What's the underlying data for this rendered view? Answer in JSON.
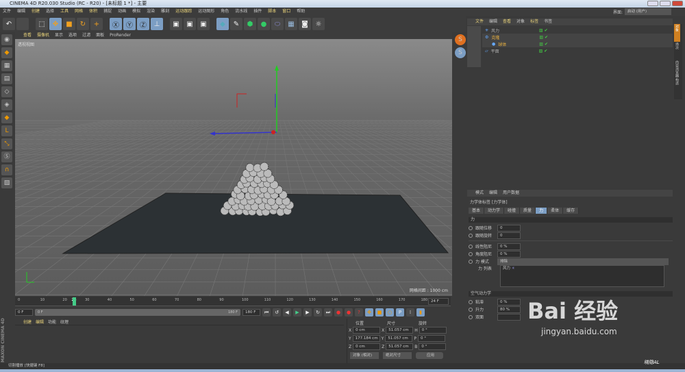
{
  "window": {
    "title": "CINEMA 4D R20.030 Studio (RC - R20) - [未标题 1 *] - 主要"
  },
  "menu": [
    {
      "label": "文件"
    },
    {
      "label": "编辑"
    },
    {
      "label": "创建",
      "hl": true
    },
    {
      "label": "选择"
    },
    {
      "label": "工具",
      "hl": true
    },
    {
      "label": "网格",
      "hl": true
    },
    {
      "label": "体积",
      "hl": true
    },
    {
      "label": "捕捉"
    },
    {
      "label": "动画"
    },
    {
      "label": "模拟"
    },
    {
      "label": "渲染"
    },
    {
      "label": "雕刻"
    },
    {
      "label": "运动跟踪",
      "hl": true
    },
    {
      "label": "运动图形"
    },
    {
      "label": "角色"
    },
    {
      "label": "流水线"
    },
    {
      "label": "插件"
    },
    {
      "label": "脚本",
      "hl": true
    },
    {
      "label": "窗口",
      "hl": true
    },
    {
      "label": "帮助"
    }
  ],
  "layout": {
    "label": "界面:",
    "value": "启动 (用户)"
  },
  "viewport": {
    "menu": [
      "查看",
      "摄像机",
      "显示",
      "选项",
      "过滤",
      "面板",
      "ProRender"
    ],
    "name": "透视视图",
    "grid_spacing": "网格间距 : 1000 cm"
  },
  "object_manager": {
    "tabs": [
      "文件",
      "编辑",
      "查看",
      "对象",
      "标签",
      "书签"
    ],
    "objects": [
      {
        "name": "风力"
      },
      {
        "name": "克隆"
      },
      {
        "name": "球体"
      },
      {
        "name": "平面"
      }
    ]
  },
  "side_tabs": [
    "对象",
    "场次",
    "内容浏览器",
    "构造"
  ],
  "attributes": {
    "menu": [
      "模式",
      "编辑",
      "用户数据"
    ],
    "header": "力学体标签 [力学体]",
    "tabs": [
      "基本",
      "动力学",
      "碰撞",
      "质量",
      "力",
      "柔体",
      "缓存"
    ],
    "active_tab": "力",
    "section": "力",
    "fields": [
      {
        "label": "跟随位移",
        "value": "0"
      },
      {
        "label": "跟随旋转",
        "value": "0"
      },
      {
        "label": "线性阻尼",
        "value": "0 %"
      },
      {
        "label": "角度阻尼",
        "value": "0 %"
      }
    ],
    "force_mode_label": "力 模式",
    "force_mode": "排除",
    "force_list_label": "力 列表",
    "force_list_item": "风力",
    "aero_section": "空气动力学",
    "aero_fields": [
      {
        "label": "粘滞",
        "value": "0 %"
      },
      {
        "label": "升力",
        "value": "80 %"
      },
      {
        "label": "双面",
        "value": ""
      }
    ]
  },
  "timeline": {
    "ticks": [
      "0",
      "10",
      "20",
      "24",
      "30",
      "40",
      "50",
      "60",
      "70",
      "80",
      "90",
      "100",
      "110",
      "120",
      "130",
      "140",
      "150",
      "160",
      "170",
      "180"
    ],
    "end_frame": "24 F",
    "current_frame": "24"
  },
  "playback": {
    "start": "0 F",
    "range_start": "0 F",
    "range_end": "180 F",
    "end": "180 F"
  },
  "material": {
    "menu": [
      "创建",
      "编辑",
      "功能",
      "纹理"
    ]
  },
  "coords": {
    "headers": [
      "位置",
      "尺寸",
      "旋转"
    ],
    "rows": [
      {
        "a": "X",
        "pos": "0 cm",
        "b": "X",
        "size": "51.057 cm",
        "c": "H",
        "rot": "0 °"
      },
      {
        "a": "Y",
        "pos": "177.184 cm",
        "b": "Y",
        "size": "51.057 cm",
        "c": "P",
        "rot": "0 °"
      },
      {
        "a": "Z",
        "pos": "0 cm",
        "b": "Z",
        "size": "51.057 cm",
        "c": "B",
        "rot": "0 °"
      }
    ],
    "mode": "对象 (相对)",
    "size_mode": "绝对尺寸",
    "apply": "应用"
  },
  "status": "切割播放 [快捷键 F8]",
  "logo": "MAXON CINEMA 4D",
  "watermark": {
    "text": "Bai 经验",
    "url": "jingyan.baidu.com",
    "author": "晓隐AL"
  }
}
